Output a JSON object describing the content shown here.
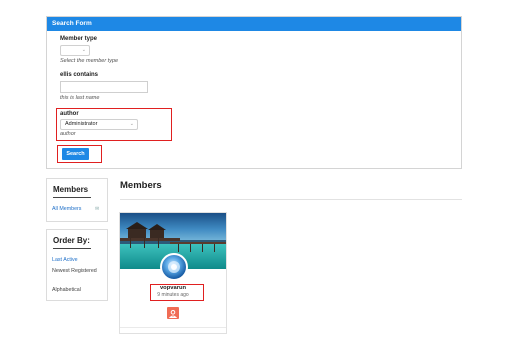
{
  "search_form": {
    "title": "Search Form",
    "member_type": {
      "label": "Member type",
      "selected": "",
      "help": "Select the member type"
    },
    "ellis": {
      "label": "ellis contains",
      "value": "",
      "help": "this is last name"
    },
    "author": {
      "label": "author",
      "selected": "Administrator",
      "help": "author"
    },
    "search_button": "Search"
  },
  "members_widget": {
    "title": "Members",
    "link": "All Members"
  },
  "order_widget": {
    "title": "Order By:",
    "options": [
      "Last Active",
      "Newest Registered",
      "Alphabetical"
    ]
  },
  "members": {
    "heading": "Members",
    "cards": [
      {
        "name": "vopvarun",
        "time": "9 minutes ago"
      }
    ]
  },
  "colors": {
    "header": "#1e88e5",
    "highlight": "#e02020",
    "link": "#1e6fc8",
    "follow": "#f06c55"
  }
}
